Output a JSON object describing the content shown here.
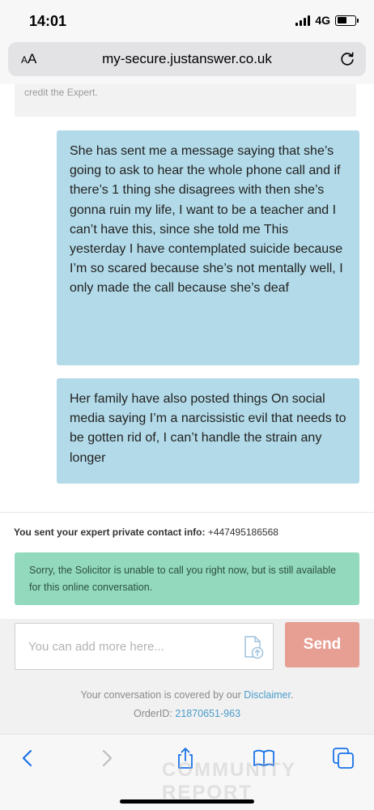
{
  "status_bar": {
    "time": "14:01",
    "network": "4G"
  },
  "browser": {
    "aa_label_small": "A",
    "aa_label_large": "A",
    "url": "my-secure.justanswer.co.uk"
  },
  "chat": {
    "previous_message_fragment": "credit the Expert.",
    "messages": [
      "She has sent me a message saying that she’s going to ask to hear the whole phone call and if there’s 1 thing she disagrees with then she’s gonna ruin my life, I want to be a teacher and I can’t have this, since she told me This yesterday I have contemplated suicide because I’m so scared because she’s not mentally well, I only made the call because she’s deaf",
      "Her family have also posted things On social media saying I’m a narcissistic evil that needs to be gotten rid of, I can’t handle the strain any longer"
    ],
    "contact_info_label": "You sent your expert private contact info:",
    "contact_info_value": "+447495186568",
    "notice": "Sorry, the Solicitor is unable to call you right now, but is still available for this online conversation."
  },
  "composer": {
    "placeholder": "You can add more here...",
    "send_label": "Send"
  },
  "footer": {
    "coverage_text": "Your conversation is covered by our",
    "disclaimer_link": "Disclaimer",
    "period": ".",
    "order_label": "OrderID:",
    "order_id": "21870651-963"
  },
  "toolbar": {
    "watermark": "COMMUNITY REPORT"
  },
  "colors": {
    "user_bubble": "#b2dae8",
    "notice_bg": "#93d9bd",
    "send_button": "#e79f93",
    "link": "#4a9ccc",
    "ios_blue": "#1a73e8"
  },
  "icons": {
    "reload": "reload-icon",
    "attach": "attach-file-icon",
    "back": "chevron-left-icon",
    "forward": "chevron-right-icon",
    "share": "share-icon",
    "bookmarks": "book-icon",
    "tabs": "tabs-icon"
  }
}
